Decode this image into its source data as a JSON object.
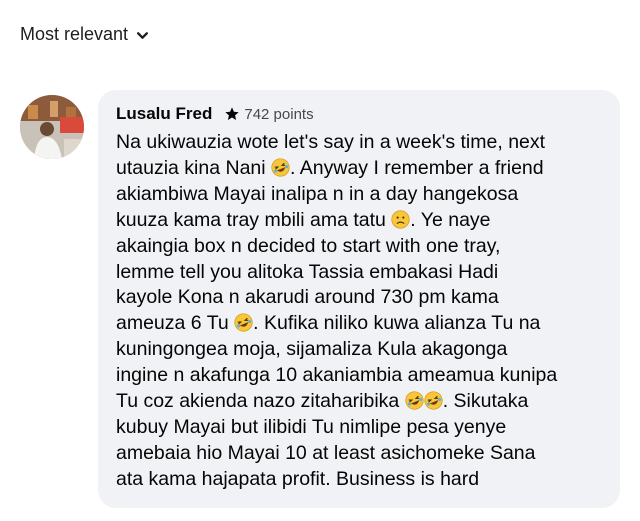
{
  "sort": {
    "label": "Most relevant",
    "icon": "chevron-down-icon"
  },
  "comment": {
    "author": "Lusalu Fred",
    "badge": {
      "icon": "star-icon",
      "text": "742 points"
    },
    "avatar": {
      "icon": "avatar-photo"
    },
    "lines": [
      [
        "Na ukiwauzia wote let's say in a week's time, next"
      ],
      [
        "utauzia kina Nani ",
        "@laugh",
        ". Anyway I remember a friend"
      ],
      [
        "akiambiwa Mayai inalipa  n in a day hangekosa"
      ],
      [
        "kuuza kama tray mbili ama tatu ",
        "@worried",
        ". Ye naye"
      ],
      [
        "akaingia box n decided to start with one tray,"
      ],
      [
        "lemme tell you alitoka Tassia embakasi Hadi"
      ],
      [
        "kayole Kona n akarudi around 730 pm kama"
      ],
      [
        "ameuza 6 Tu ",
        "@laugh",
        ". Kufika niliko kuwa alianza Tu na"
      ],
      [
        "kuningongea moja, sijamaliza Kula akagonga"
      ],
      [
        "ingine n akafunga 10 akaniambia ameamua kunipa"
      ],
      [
        "Tu coz akienda nazo zitaharibika ",
        "@laugh",
        "@laugh",
        ". Sikutaka"
      ],
      [
        "kubuy Mayai but ilibidi Tu nimlipe pesa yenye"
      ],
      [
        "amebaia hio Mayai 10 at least asichomeke Sana"
      ],
      [
        "ata kama hajapata profit. Business is hard"
      ]
    ],
    "emoji": {
      "laugh": "rolling-on-floor-laughing-emoji",
      "worried": "slightly-frowning-emoji"
    }
  }
}
